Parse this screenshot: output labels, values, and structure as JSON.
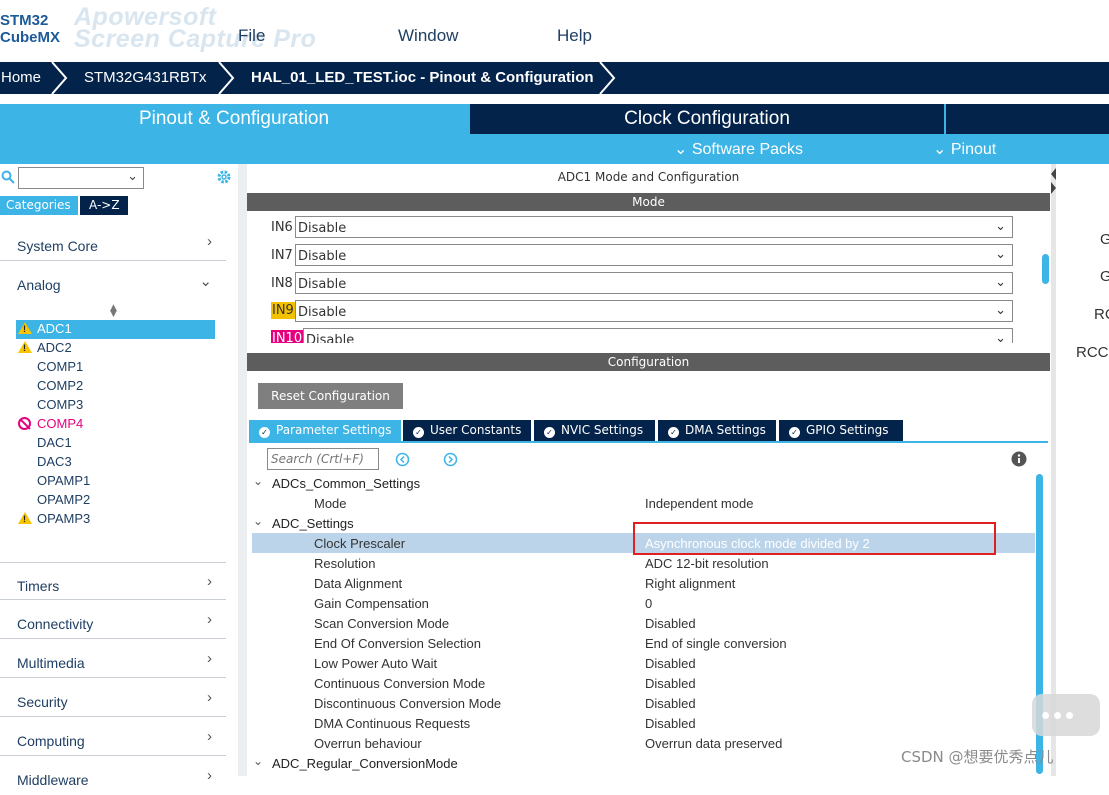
{
  "app": {
    "logo_line1": "STM32",
    "logo_line2": "CubeMX",
    "watermark_line1": "Apowersoft",
    "watermark_line2": "Screen Capture Pro"
  },
  "menu": [
    "File",
    "Window",
    "Help"
  ],
  "breadcrumb": [
    "Home",
    "STM32G431RBTx",
    "HAL_01_LED_TEST.ioc - Pinout & Configuration"
  ],
  "main_tabs": {
    "pinout": "Pinout & Configuration",
    "clock": "Clock Configuration"
  },
  "sub_tabs": {
    "software_packs": "Software Packs",
    "pinout": "Pinout"
  },
  "sidebar": {
    "search_value": "",
    "categories_tab": "Categories",
    "az_tab": "A->Z",
    "categories": {
      "system_core": "System Core",
      "analog": "Analog",
      "timers": "Timers",
      "connectivity": "Connectivity",
      "multimedia": "Multimedia",
      "security": "Security",
      "computing": "Computing",
      "middleware": "Middleware"
    },
    "analog_items": [
      {
        "label": "ADC1",
        "status": "warning",
        "selected": true
      },
      {
        "label": "ADC2",
        "status": "warning",
        "selected": false
      },
      {
        "label": "COMP1",
        "status": "none",
        "selected": false
      },
      {
        "label": "COMP2",
        "status": "none",
        "selected": false
      },
      {
        "label": "COMP3",
        "status": "none",
        "selected": false
      },
      {
        "label": "COMP4",
        "status": "disabled",
        "selected": false
      },
      {
        "label": "DAC1",
        "status": "none",
        "selected": false
      },
      {
        "label": "DAC3",
        "status": "none",
        "selected": false
      },
      {
        "label": "OPAMP1",
        "status": "none",
        "selected": false
      },
      {
        "label": "OPAMP2",
        "status": "none",
        "selected": false
      },
      {
        "label": "OPAMP3",
        "status": "warning",
        "selected": false
      }
    ]
  },
  "center": {
    "title": "ADC1 Mode and Configuration",
    "mode_header": "Mode",
    "mode_rows": [
      {
        "pin": "IN6",
        "value": "Disable",
        "highlight": ""
      },
      {
        "pin": "IN7",
        "value": "Disable",
        "highlight": ""
      },
      {
        "pin": "IN8",
        "value": "Disable",
        "highlight": ""
      },
      {
        "pin": "IN9",
        "value": "Disable",
        "highlight": "#f2c200"
      },
      {
        "pin": "IN10",
        "value": "Disable",
        "highlight": "#e6007e"
      }
    ],
    "config_header": "Configuration",
    "reset_button": "Reset Configuration",
    "param_tabs": [
      "Parameter Settings",
      "User Constants",
      "NVIC Settings",
      "DMA Settings",
      "GPIO Settings"
    ],
    "search_placeholder": "Search (Crtl+F)",
    "param_tree": [
      {
        "type": "group",
        "label": "ADCs_Common_Settings"
      },
      {
        "type": "param",
        "key": "Mode",
        "value": "Independent mode"
      },
      {
        "type": "group",
        "label": "ADC_Settings"
      },
      {
        "type": "param",
        "key": "Clock Prescaler",
        "value": "Asynchronous clock mode divided by 2",
        "selected": true
      },
      {
        "type": "param",
        "key": "Resolution",
        "value": "ADC 12-bit resolution"
      },
      {
        "type": "param",
        "key": "Data Alignment",
        "value": "Right alignment"
      },
      {
        "type": "param",
        "key": "Gain Compensation",
        "value": "0"
      },
      {
        "type": "param",
        "key": "Scan Conversion Mode",
        "value": "Disabled"
      },
      {
        "type": "param",
        "key": "End Of Conversion Selection",
        "value": "End of single conversion"
      },
      {
        "type": "param",
        "key": "Low Power Auto Wait",
        "value": "Disabled"
      },
      {
        "type": "param",
        "key": "Continuous Conversion Mode",
        "value": "Disabled"
      },
      {
        "type": "param",
        "key": "Discontinuous Conversion Mode",
        "value": "Disabled"
      },
      {
        "type": "param",
        "key": "DMA Continuous Requests",
        "value": "Disabled"
      },
      {
        "type": "param",
        "key": "Overrun behaviour",
        "value": "Overrun data preserved"
      },
      {
        "type": "group",
        "label": "ADC_Regular_ConversionMode"
      }
    ]
  },
  "right_panel": [
    "G",
    "G",
    "RC",
    "RCC"
  ],
  "footer_watermark": "CSDN @想要优秀点儿",
  "colors": {
    "navy": "#03234b",
    "cyan": "#3cb4e6",
    "magenta": "#e6007e",
    "warning": "#f6c400"
  }
}
